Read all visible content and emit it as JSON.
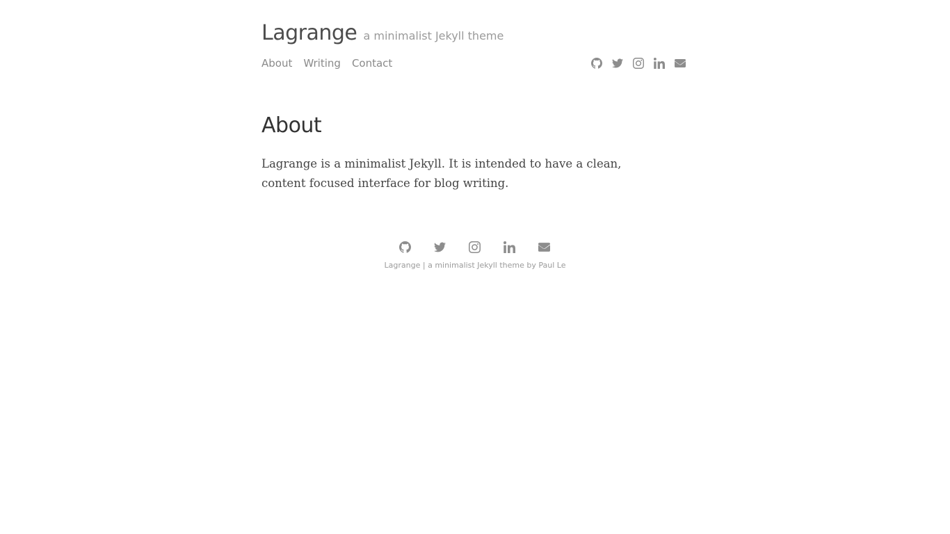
{
  "site": {
    "title": "Lagrange",
    "tagline": "a minimalist Jekyll theme"
  },
  "nav": {
    "items": [
      {
        "label": "About"
      },
      {
        "label": "Writing"
      },
      {
        "label": "Contact"
      }
    ]
  },
  "social": {
    "icons": [
      "github-icon",
      "twitter-icon",
      "instagram-icon",
      "linkedin-icon",
      "envelope-icon"
    ]
  },
  "page": {
    "title": "About",
    "body": "Lagrange is a minimalist Jekyll. It is intended to have a clean, content focused interface for blog writing."
  },
  "footer": {
    "site_name": "Lagrange",
    "separator": " | ",
    "tagline": "a minimalist Jekyll theme by ",
    "author": "Paul Le"
  },
  "colors": {
    "text": "#4c4c4c",
    "muted": "#8d8d8d",
    "heading": "#333333"
  }
}
